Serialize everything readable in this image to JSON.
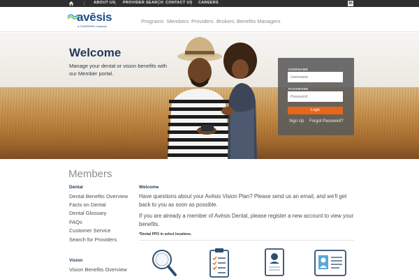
{
  "topbar": {
    "links": [
      "ABOUT US",
      "PROVIDER SEARCH",
      "CONTACT US",
      "CAREERS"
    ],
    "home_icon": "home-icon",
    "social_icon": "linkedin-icon",
    "social_label": "in"
  },
  "header": {
    "logo_text": "avēsis",
    "logo_tagline": "a GUARDIAN company",
    "nav": [
      "Programs",
      "Members",
      "Providers",
      "Brokers",
      "Benefits Managers"
    ]
  },
  "hero": {
    "title": "Welcome",
    "subtitle": "Manage your dental or vision benefits with our Member portal."
  },
  "login": {
    "username_label": "USERNAME",
    "username_placeholder": "Username",
    "password_label": "PASSWORD",
    "password_placeholder": "Password",
    "login_button": "Login",
    "signup_link": "Sign Up",
    "forgot_link": "Forgot Password?"
  },
  "members": {
    "title": "Members",
    "dental_heading": "Dental",
    "dental_links": [
      "Dental Benefits Overview",
      "Facts on Dental",
      "Dental Glossary",
      "FAQs",
      "Customer Service",
      "Search for Providers"
    ],
    "vision_heading": "Vision",
    "vision_links": [
      "Vision Benefits Overview"
    ],
    "main_heading": "Welcome",
    "para1": "Have questions about your Avēsis Vision Plan? Please send us an email, and we'll get back to you as soon as possible.",
    "para2": "If you are already a member of Avēsis Dental, please register a new account to view your benefits.",
    "note": "*Dental PPO in select locations.",
    "tiles": [
      "magnifier-icon",
      "clipboard-checklist-icon",
      "document-profile-icon",
      "id-card-icon"
    ]
  },
  "colors": {
    "brand_blue": "#1b4f8a",
    "login_orange": "#e8661c",
    "topbar_bg": "#2f2f2f"
  }
}
